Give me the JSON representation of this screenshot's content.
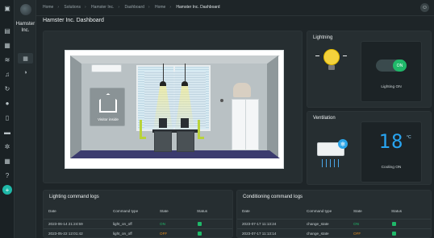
{
  "app": {
    "tenant": "Hamster Inc.",
    "page_title": "Hamster Inc. Dashboard"
  },
  "breadcrumb": [
    "Home",
    "Solutions",
    "Hamster Inc.",
    "Dashboard",
    "Home",
    "Hamster Inc. Dashboard"
  ],
  "scene": {
    "visitor_label": "Visitor inside"
  },
  "lighting": {
    "title": "Lightning",
    "toggle_label": "ON",
    "status": "Lighting ON"
  },
  "ventilation": {
    "title": "Ventilation",
    "temperature": "18",
    "unit": "°C",
    "status": "Cooling ON"
  },
  "lighting_logs": {
    "title": "Lighting command logs",
    "columns": [
      "Date",
      "Command type",
      "State",
      "Status"
    ],
    "rows": [
      {
        "date": "2023-06-14 21:24:59",
        "type": "light_on_off",
        "state": "ON"
      },
      {
        "date": "2023-05-22 12:01:42",
        "type": "light_on_off",
        "state": "OFF"
      }
    ]
  },
  "conditioning_logs": {
    "title": "Conditioning command logs",
    "columns": [
      "Date",
      "Command type",
      "State",
      "Status"
    ],
    "rows": [
      {
        "date": "2023-07-17 11:13:24",
        "type": "change_state",
        "state": "ON"
      },
      {
        "date": "2023-07-17 11:13:14",
        "type": "change_state",
        "state": "OFF"
      }
    ]
  },
  "colors": {
    "accent": "#1fb8a8",
    "success": "#1fb869",
    "warning": "#e08a1e",
    "temperature": "#28a4f0",
    "bulb": "#f4d23c"
  },
  "icons": {
    "rail": [
      "dashboard-icon",
      "apps-icon",
      "signal-icon",
      "bell-icon",
      "refresh-icon",
      "person-icon",
      "devices-icon",
      "folder-icon",
      "gear-icon",
      "grid-icon",
      "help-icon",
      "plus-icon"
    ],
    "side": [
      "dashboard-icon",
      "palette-icon"
    ]
  }
}
